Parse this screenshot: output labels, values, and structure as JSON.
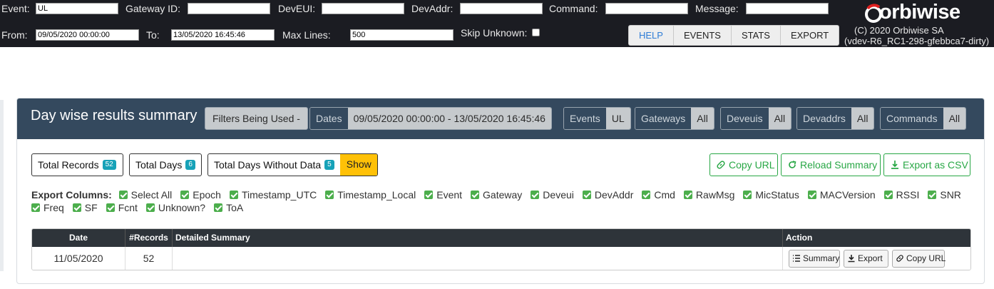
{
  "topbar": {
    "event_label": "Event:",
    "event_value": "UL",
    "gateway_label": "Gateway ID:",
    "gateway_value": "",
    "deveui_label": "DevEUI:",
    "deveui_value": "",
    "devaddr_label": "DevAddr:",
    "devaddr_value": "",
    "command_label": "Command:",
    "command_value": "",
    "message_label": "Message:",
    "message_value": "",
    "from_label": "From:",
    "from_value": "09/05/2020 00:00:00",
    "to_label": "To:",
    "to_value": "13/05/2020 16:45:46",
    "maxlines_label": "Max Lines:",
    "maxlines_value": "500",
    "skip_label": "Skip Unknown:",
    "skip_checked": false,
    "nav": [
      "HELP",
      "EVENTS",
      "STATS",
      "EXPORT"
    ],
    "nav_active": "HELP",
    "brand": "orbiwise",
    "copyright": "(C) 2020 Orbiwise SA",
    "version": "(vdev-R6_RC1-298-gfebbca7-dirty)"
  },
  "summary": {
    "title": "Day wise results summary",
    "filters_label": "Filters Being Used -",
    "filters": {
      "dates_key": "Dates",
      "dates_value": "09/05/2020 00:00:00 - 13/05/2020 16:45:46",
      "events_key": "Events",
      "events_value": "UL",
      "gateways_key": "Gateways",
      "gateways_value": "All",
      "deveuis_key": "Deveuis",
      "deveuis_value": "All",
      "devaddrs_key": "Devaddrs",
      "devaddrs_value": "All",
      "commands_key": "Commands",
      "commands_value": "All"
    },
    "stats": {
      "total_records_label": "Total Records",
      "total_records": "52",
      "total_days_label": "Total Days",
      "total_days": "6",
      "days_without_data_label": "Total Days Without Data",
      "days_without_data": "5",
      "show_label": "Show"
    },
    "actions": {
      "copy_url": "Copy URL",
      "reload_summary": "Reload Summary",
      "export_csv": "Export as CSV"
    },
    "export_columns_label": "Export Columns:",
    "export_columns_row1": [
      "Select All",
      "Epoch",
      "Timestamp_UTC",
      "Timestamp_Local",
      "Event",
      "Gateway",
      "Deveui",
      "DevAddr",
      "Cmd",
      "RawMsg",
      "MicStatus",
      "MACVersion",
      "RSSI",
      "SNR"
    ],
    "export_columns_row2": [
      "Freq",
      "SF",
      "Fcnt",
      "Unknown?",
      "ToA"
    ],
    "table": {
      "headers": [
        "Date",
        "#Records",
        "Detailed Summary",
        "Action"
      ],
      "rows": [
        {
          "date": "11/05/2020",
          "records": "52",
          "detail": ""
        }
      ],
      "row_actions": [
        "Summary",
        "Export",
        "Copy URL"
      ]
    }
  }
}
